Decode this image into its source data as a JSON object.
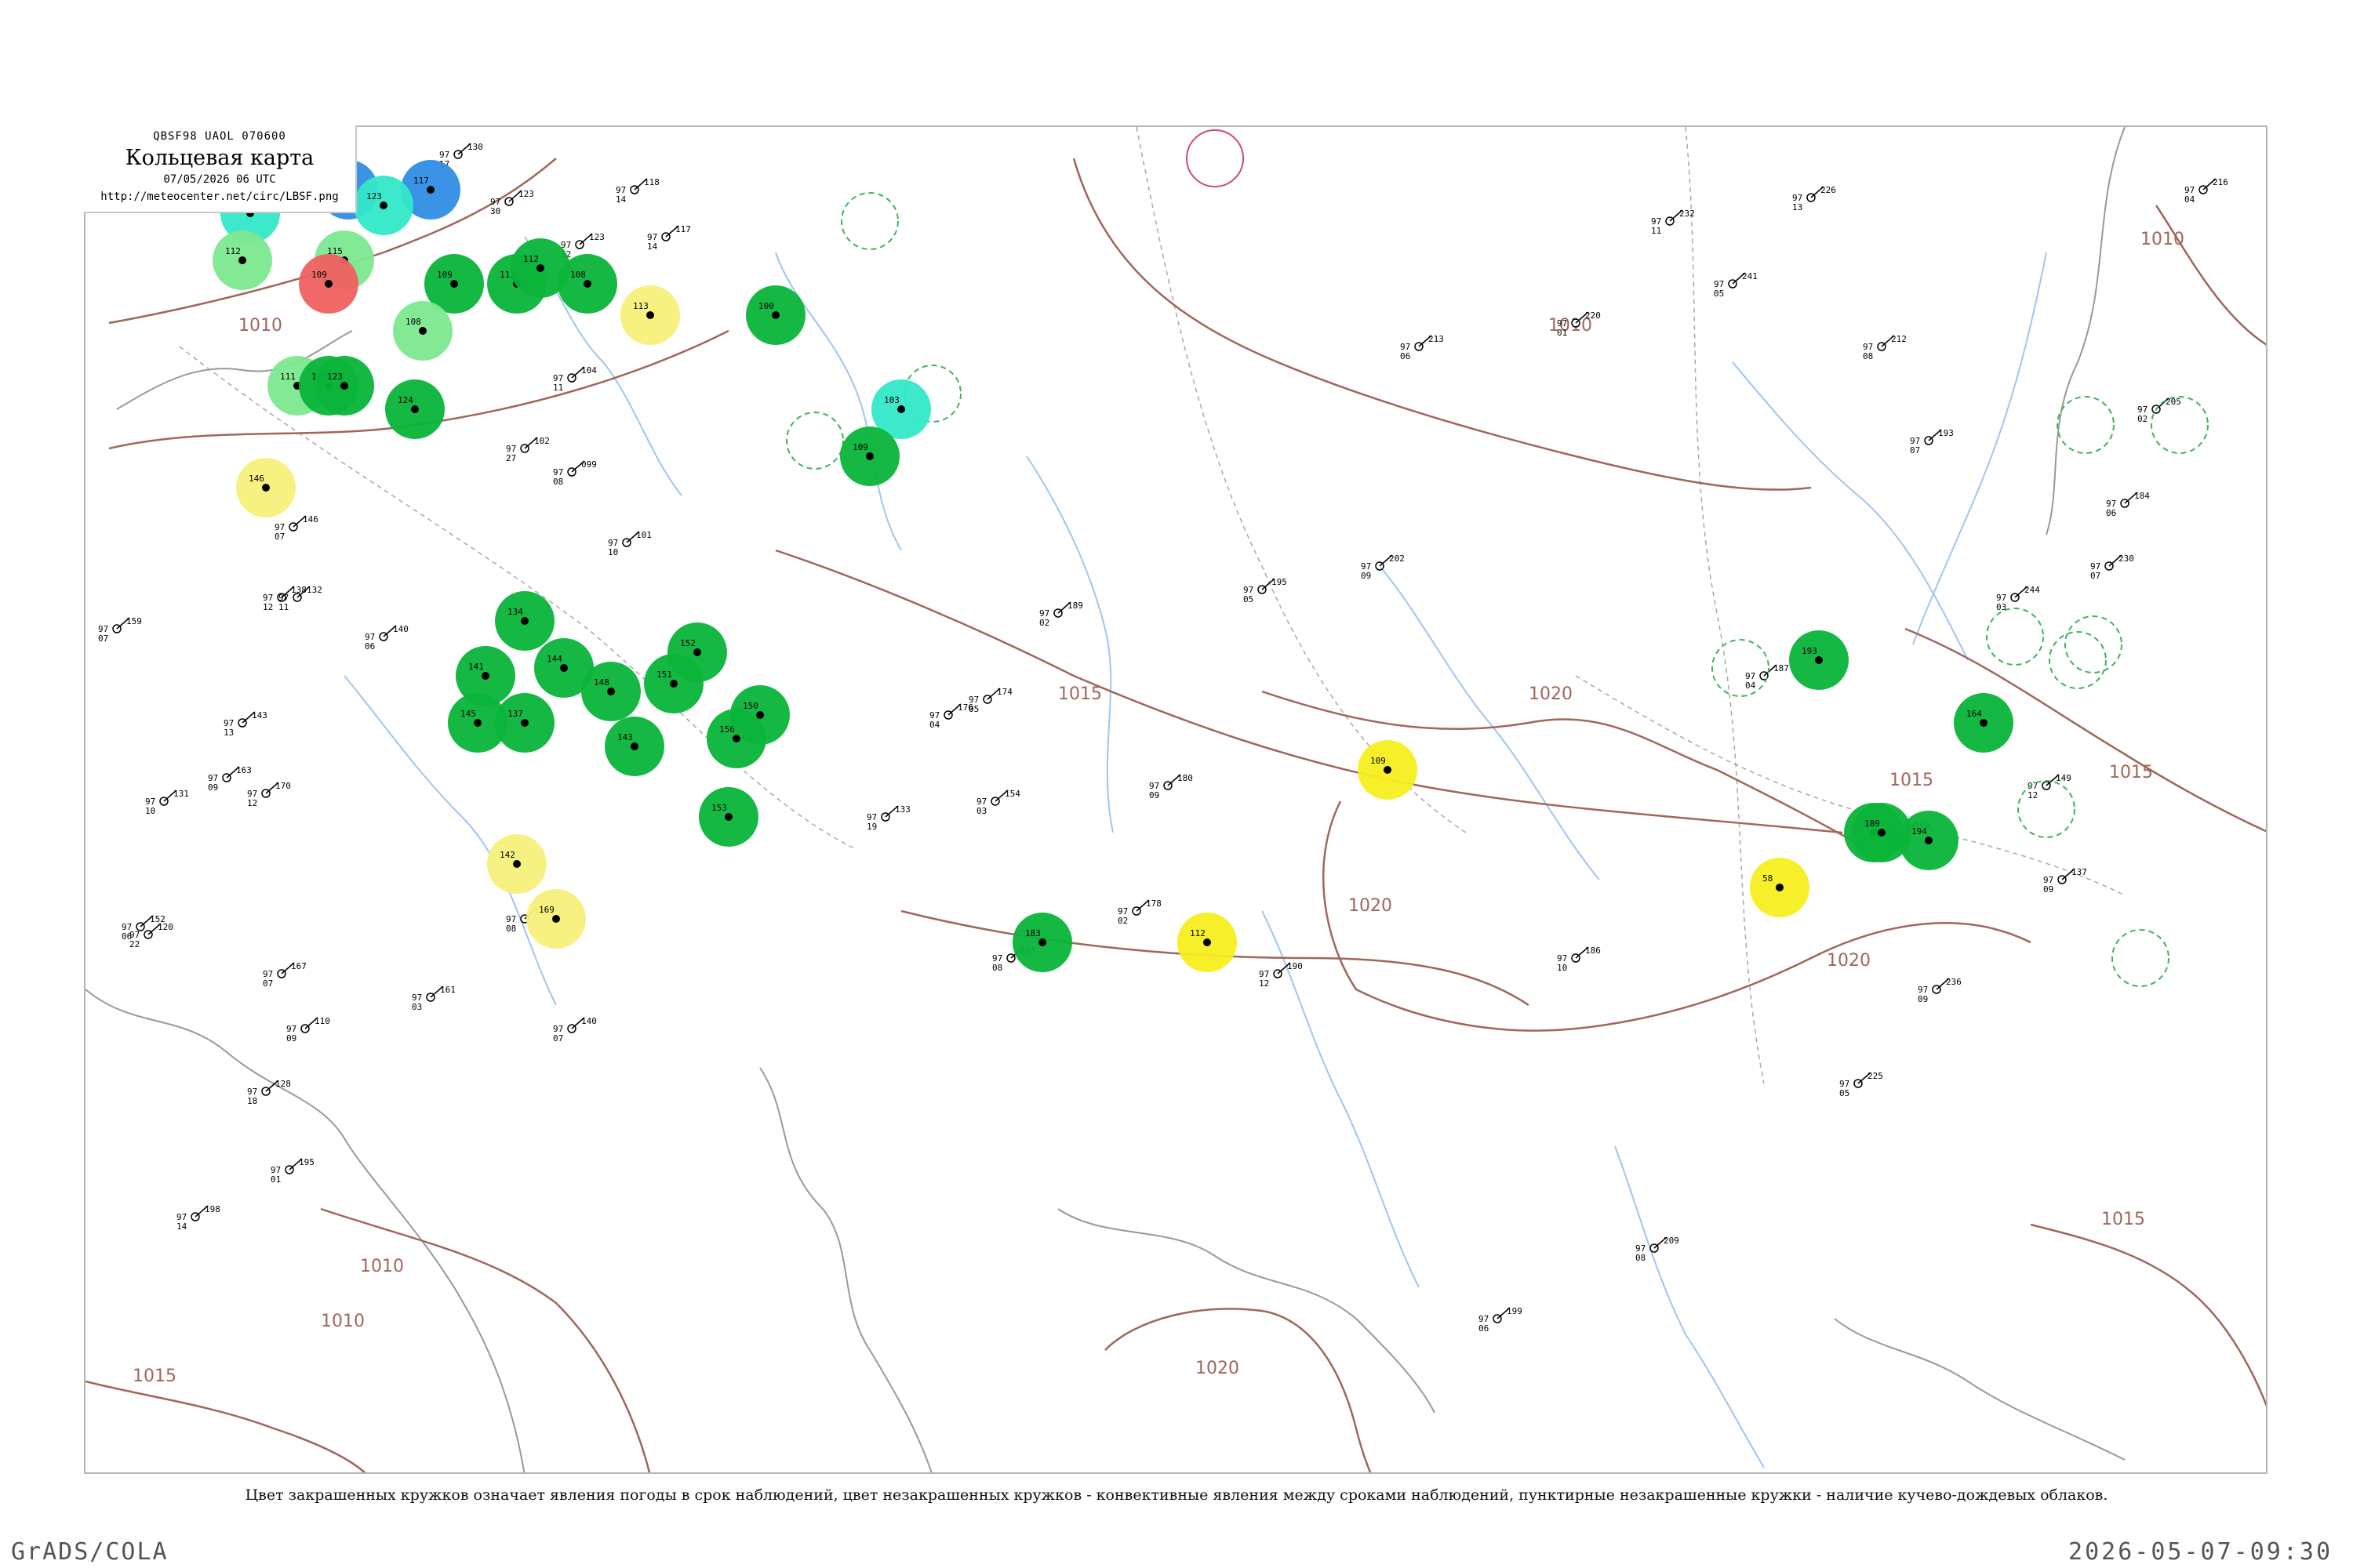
{
  "header": {
    "codes": "QBSF98  UAOL  070600",
    "title": "Кольцевая карта",
    "time": "07/05/2026 06 UTC",
    "url": "http://meteocenter.net/circ/LBSF.png"
  },
  "isobar_labels": [
    "1010",
    "1010",
    "1010",
    "1010",
    "1015",
    "1015",
    "1015",
    "1015",
    "1020",
    "1020",
    "1020",
    "1020",
    "1010",
    "1015"
  ],
  "stations": [
    {
      "pressure": "130",
      "temp": "97",
      "dew": "17"
    },
    {
      "pressure": "123",
      "temp": "97",
      "dew": "30"
    },
    {
      "pressure": "118",
      "temp": "97",
      "dew": "14"
    },
    {
      "pressure": "123",
      "temp": "97",
      "dew": "12"
    },
    {
      "pressure": "117",
      "temp": "97",
      "dew": "14"
    },
    {
      "pressure": "102",
      "temp": "97",
      "dew": "27"
    },
    {
      "pressure": "104",
      "temp": "97",
      "dew": "11"
    },
    {
      "pressure": "099",
      "temp": "97",
      "dew": "08"
    },
    {
      "pressure": "101",
      "temp": "97",
      "dew": "10"
    },
    {
      "pressure": "146",
      "temp": "97",
      "dew": "07"
    },
    {
      "pressure": "138",
      "temp": "97",
      "dew": "12"
    },
    {
      "pressure": "132",
      "temp": "97",
      "dew": "11"
    },
    {
      "pressure": "140",
      "temp": "97",
      "dew": "06"
    },
    {
      "pressure": "159",
      "temp": "97",
      "dew": "07"
    },
    {
      "pressure": "163",
      "temp": "97",
      "dew": "09"
    },
    {
      "pressure": "170",
      "temp": "97",
      "dew": "12"
    },
    {
      "pressure": "152",
      "temp": "97",
      "dew": "06"
    },
    {
      "pressure": "167",
      "temp": "97",
      "dew": "07"
    },
    {
      "pressure": "110",
      "temp": "97",
      "dew": "09"
    },
    {
      "pressure": "128",
      "temp": "97",
      "dew": "18"
    },
    {
      "pressure": "198",
      "temp": "97",
      "dew": "14"
    },
    {
      "pressure": "195",
      "temp": "97",
      "dew": "01"
    },
    {
      "pressure": "175",
      "temp": "97",
      "dew": "08"
    },
    {
      "pressure": "161",
      "temp": "97",
      "dew": "03"
    },
    {
      "pressure": "140",
      "temp": "97",
      "dew": "07"
    },
    {
      "pressure": "120",
      "temp": "97",
      "dew": "22"
    },
    {
      "pressure": "131",
      "temp": "97",
      "dew": "10"
    },
    {
      "pressure": "143",
      "temp": "97",
      "dew": "13"
    },
    {
      "pressure": "176",
      "temp": "97",
      "dew": "04"
    },
    {
      "pressure": "189",
      "temp": "97",
      "dew": "02"
    },
    {
      "pressure": "174",
      "temp": "97",
      "dew": "05"
    },
    {
      "pressure": "154",
      "temp": "97",
      "dew": "03"
    },
    {
      "pressure": "133",
      "temp": "97",
      "dew": "19"
    },
    {
      "pressure": "165",
      "temp": "97",
      "dew": "08"
    },
    {
      "pressure": "180",
      "temp": "97",
      "dew": "09"
    },
    {
      "pressure": "178",
      "temp": "97",
      "dew": "02"
    },
    {
      "pressure": "195",
      "temp": "97",
      "dew": "05"
    },
    {
      "pressure": "190",
      "temp": "97",
      "dew": "12"
    },
    {
      "pressure": "202",
      "temp": "97",
      "dew": "09"
    },
    {
      "pressure": "213",
      "temp": "97",
      "dew": "06"
    },
    {
      "pressure": "220",
      "temp": "97",
      "dew": "01"
    },
    {
      "pressure": "232",
      "temp": "97",
      "dew": "11"
    },
    {
      "pressure": "241",
      "temp": "97",
      "dew": "05"
    },
    {
      "pressure": "226",
      "temp": "97",
      "dew": "13"
    },
    {
      "pressure": "212",
      "temp": "97",
      "dew": "08"
    },
    {
      "pressure": "193",
      "temp": "97",
      "dew": "07"
    },
    {
      "pressure": "187",
      "temp": "97",
      "dew": "04"
    },
    {
      "pressure": "166",
      "temp": "97",
      "dew": "10"
    },
    {
      "pressure": "149",
      "temp": "97",
      "dew": "12"
    },
    {
      "pressure": "137",
      "temp": "97",
      "dew": "09"
    },
    {
      "pressure": "184",
      "temp": "97",
      "dew": "06"
    },
    {
      "pressure": "205",
      "temp": "97",
      "dew": "02"
    },
    {
      "pressure": "216",
      "temp": "97",
      "dew": "04"
    },
    {
      "pressure": "230",
      "temp": "97",
      "dew": "07"
    },
    {
      "pressure": "244",
      "temp": "97",
      "dew": "03"
    },
    {
      "pressure": "236",
      "temp": "97",
      "dew": "09"
    },
    {
      "pressure": "225",
      "temp": "97",
      "dew": "05"
    },
    {
      "pressure": "209",
      "temp": "97",
      "dew": "08"
    },
    {
      "pressure": "199",
      "temp": "97",
      "dew": "06"
    },
    {
      "pressure": "186",
      "temp": "97",
      "dew": "10"
    }
  ],
  "weather_circles": [
    {
      "color": "#2f8de4",
      "label": "130"
    },
    {
      "color": "#2f8de4",
      "label": "117"
    },
    {
      "color": "#33e8c8",
      "label": "147"
    },
    {
      "color": "#33e8c8",
      "label": "123"
    },
    {
      "color": "#7de88f",
      "label": "115"
    },
    {
      "color": "#7de88f",
      "label": "112"
    },
    {
      "color": "#f06060",
      "label": "109"
    },
    {
      "color": "#0ab43a",
      "label": "109"
    },
    {
      "color": "#0ab43a",
      "label": "111"
    },
    {
      "color": "#0ab43a",
      "label": "108"
    },
    {
      "color": "#0ab43a",
      "label": "112"
    },
    {
      "color": "#f5f07a",
      "label": "113"
    },
    {
      "color": "#0ab43a",
      "label": "100"
    },
    {
      "color": "#7de88f",
      "label": "111"
    },
    {
      "color": "#0ab43a",
      "label": "121"
    },
    {
      "color": "#0ab43a",
      "label": "123"
    },
    {
      "color": "#0ab43a",
      "label": "124"
    },
    {
      "color": "#7de88f",
      "label": "108"
    },
    {
      "color": "#33e8c8",
      "label": "103"
    },
    {
      "color": "#0ab43a",
      "label": "109"
    },
    {
      "color": "#f5f07a",
      "label": "146"
    },
    {
      "color": "#0ab43a",
      "label": "134"
    },
    {
      "color": "#0ab43a",
      "label": "141"
    },
    {
      "color": "#0ab43a",
      "label": "145"
    },
    {
      "color": "#0ab43a",
      "label": "137"
    },
    {
      "color": "#0ab43a",
      "label": "144"
    },
    {
      "color": "#0ab43a",
      "label": "148"
    },
    {
      "color": "#0ab43a",
      "label": "151"
    },
    {
      "color": "#0ab43a",
      "label": "152"
    },
    {
      "color": "#0ab43a",
      "label": "143"
    },
    {
      "color": "#0ab43a",
      "label": "156"
    },
    {
      "color": "#0ab43a",
      "label": "150"
    },
    {
      "color": "#0ab43a",
      "label": "153"
    },
    {
      "color": "#f5f07a",
      "label": "142"
    },
    {
      "color": "#f5f07a",
      "label": "169"
    },
    {
      "color": "#0ab43a",
      "label": "183"
    },
    {
      "color": "#f5ee1e",
      "label": "112"
    },
    {
      "color": "#f5ee1e",
      "label": "109"
    },
    {
      "color": "#0ab43a",
      "label": "193"
    },
    {
      "color": "#0ab43a",
      "label": "216"
    },
    {
      "color": "#f5ee1e",
      "label": "58"
    },
    {
      "color": "#0ab43a",
      "label": "189"
    },
    {
      "color": "#0ab43a",
      "label": "194"
    },
    {
      "color": "#0ab43a",
      "label": "164"
    }
  ],
  "convective_circles": [
    {
      "color": "#d04a6a"
    },
    {
      "color": "#3ab45a"
    },
    {
      "color": "#3ab45a"
    },
    {
      "color": "#3ab45a"
    },
    {
      "color": "#3ab45a"
    },
    {
      "color": "#3ab45a"
    },
    {
      "color": "#3ab45a"
    },
    {
      "color": "#3ab45a"
    },
    {
      "color": "#3ab45a"
    },
    {
      "color": "#3ab45a"
    },
    {
      "color": "#3ab45a"
    },
    {
      "color": "#3ab45a"
    }
  ],
  "caption": "Цвет закрашенных кружков означает явления погоды в срок наблюдений, цвет незакрашенных кружков - конвективные явления между сроками наблюдений, пунктирные незакрашенные кружки - наличие кучево-дождевых облаков.",
  "footer": {
    "left": "GrADS/COLA",
    "right": "2026-05-07-09:30"
  }
}
